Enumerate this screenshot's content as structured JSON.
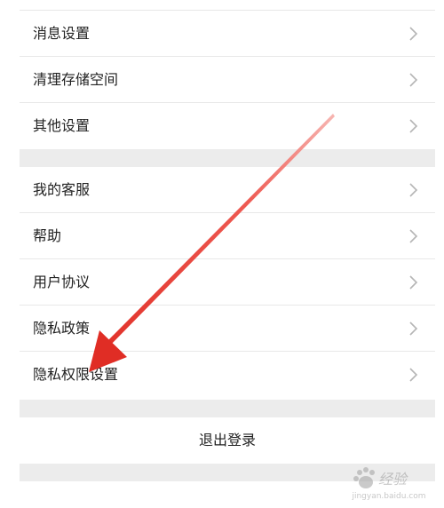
{
  "settings": {
    "group1": [
      {
        "label": "消息设置"
      },
      {
        "label": "清理存储空间"
      },
      {
        "label": "其他设置"
      }
    ],
    "group2": [
      {
        "label": "我的客服"
      },
      {
        "label": "帮助"
      },
      {
        "label": "用户协议"
      },
      {
        "label": "隐私政策"
      },
      {
        "label": "隐私权限设置"
      }
    ],
    "logout_label": "退出登录"
  },
  "annotation": {
    "color": "#e8332a",
    "target": "隐私权限设置"
  },
  "watermark": {
    "text": "经验",
    "url": "jingyan.baidu.com"
  },
  "colors": {
    "background": "#ececec",
    "card": "#ffffff",
    "text": "#222222",
    "chevron": "#b5b5b5",
    "divider": "#e8e8e8"
  }
}
